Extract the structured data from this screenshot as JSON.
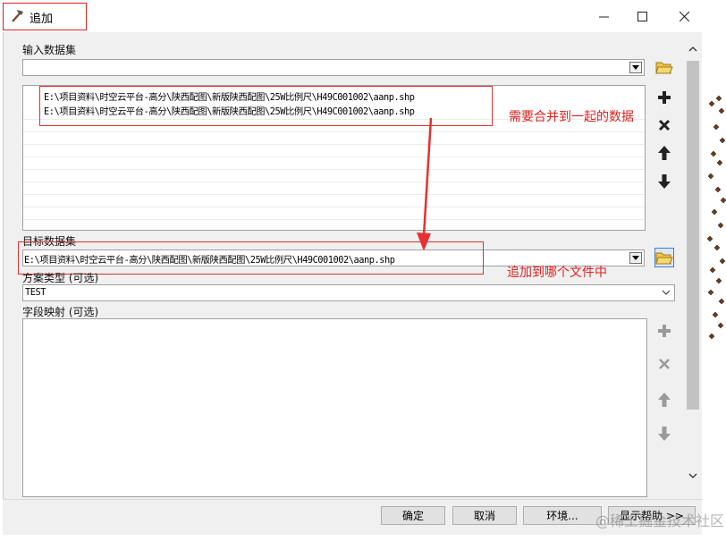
{
  "window": {
    "title": "追加",
    "icon": "hammer-icon",
    "controls": [
      "minimize-icon",
      "maximize-icon",
      "close-icon"
    ]
  },
  "input_dataset": {
    "label": "输入数据集",
    "value": "",
    "files": [
      "E:\\项目资料\\时空云平台-高分\\陕西配图\\新版陕西配图\\25W比例尺\\H49C001002\\aanp.shp",
      "E:\\项目资料\\时空云平台-高分\\陕西配图\\新版陕西配图\\25W比例尺\\H49C001002\\aanp.shp"
    ],
    "annotation": "需要合并到一起的数据"
  },
  "target_dataset": {
    "label": "目标数据集",
    "value": "E:\\项目资料\\时空云平台-高分\\陕西配图\\新版陕西配图\\25W比例尺\\H49C001002\\aanp.shp",
    "annotation": "追加到哪个文件中"
  },
  "schema_type": {
    "label": "方案类型 (可选)",
    "value": "TEST"
  },
  "field_map": {
    "label": "字段映射 (可选)"
  },
  "buttons": {
    "ok": "确定",
    "cancel": "取消",
    "env": "环境...",
    "help": "显示帮助 >>"
  },
  "watermark": "@稀土掘金技术社区",
  "colors": {
    "annotation_red": "#e02020",
    "dialog_bg": "#f0f0f0"
  }
}
